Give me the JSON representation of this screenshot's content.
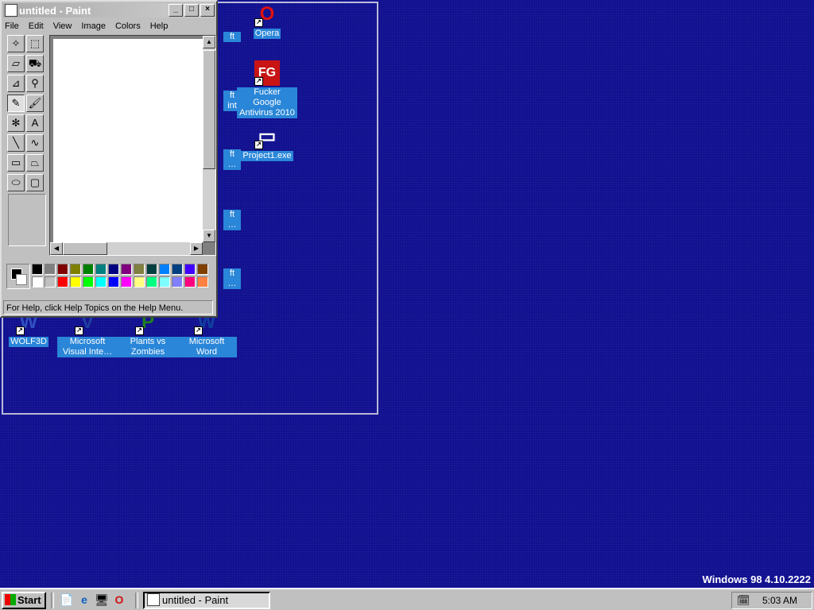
{
  "desktop": {
    "icons": [
      {
        "id": "opera",
        "label": "Opera",
        "glyph": "O",
        "color": "#e01010"
      },
      {
        "id": "fg",
        "label": "Fucker Google Antivirus 2010",
        "glyph": "FG",
        "color": "#c81414"
      },
      {
        "id": "project1",
        "label": "Project1.exe",
        "glyph": "▭",
        "color": "#ffffff"
      },
      {
        "id": "wolf3d",
        "label": "WOLF3D",
        "glyph": "W",
        "color": "#3050c0"
      },
      {
        "id": "visual",
        "label": "Microsoft Visual Inte…",
        "glyph": "V",
        "color": "#2040a0"
      },
      {
        "id": "pvz",
        "label": "Plants vs Zombies",
        "glyph": "P",
        "color": "#208020"
      },
      {
        "id": "word",
        "label": "Microsoft Word",
        "glyph": "W",
        "color": "#1040a0"
      },
      {
        "id": "partial1",
        "label": "ft",
        "glyph": "",
        "color": "#2a86d8"
      },
      {
        "id": "partial2",
        "label": "ft int",
        "glyph": "",
        "color": "#2a86d8"
      },
      {
        "id": "partial3",
        "label": "ft …",
        "glyph": "",
        "color": "#2a86d8"
      },
      {
        "id": "partial4",
        "label": "ft …",
        "glyph": "",
        "color": "#2a86d8"
      },
      {
        "id": "partial5",
        "label": "ft …",
        "glyph": "",
        "color": "#2a86d8"
      }
    ]
  },
  "paint": {
    "title": "untitled - Paint",
    "menu": [
      "File",
      "Edit",
      "View",
      "Image",
      "Colors",
      "Help"
    ],
    "tools": [
      "free-select",
      "rect-select",
      "eraser",
      "fill",
      "picker",
      "magnifier",
      "pencil",
      "brush",
      "airbrush",
      "text",
      "line",
      "curve",
      "rectangle",
      "polygon",
      "ellipse",
      "rounded-rectangle"
    ],
    "tool_glyphs": [
      "✧",
      "⬚",
      "▱",
      "⛟",
      "⊿",
      "⚲",
      "✎",
      "🖌",
      "✻",
      "A",
      "╲",
      "∿",
      "▭",
      "⏢",
      "⬭",
      "▢"
    ],
    "selected_tool": "pencil",
    "palette_top": [
      "#000000",
      "#808080",
      "#800000",
      "#808000",
      "#008000",
      "#008080",
      "#000080",
      "#800080",
      "#808040",
      "#004040",
      "#0080ff",
      "#004080",
      "#4000ff",
      "#804000"
    ],
    "palette_bottom": [
      "#ffffff",
      "#c0c0c0",
      "#ff0000",
      "#ffff00",
      "#00ff00",
      "#00ffff",
      "#0000ff",
      "#ff00ff",
      "#ffff80",
      "#00ff80",
      "#80ffff",
      "#8080ff",
      "#ff0080",
      "#ff8040"
    ],
    "status": "For Help, click Help Topics on the Help Menu."
  },
  "version_text": "Windows 98 4.10.2222",
  "taskbar": {
    "start_label": "Start",
    "quick_launch": [
      "📄",
      "e",
      "🖥",
      "O"
    ],
    "task_label": "untitled - Paint",
    "clock": "5:03 AM"
  }
}
